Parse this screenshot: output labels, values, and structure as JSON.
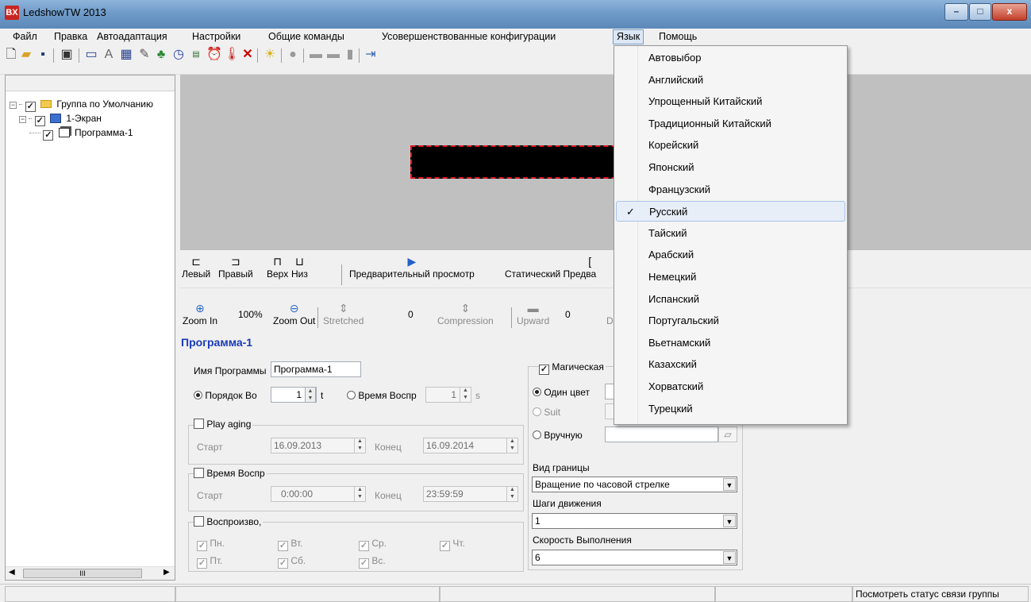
{
  "window": {
    "title": "LedshowTW 2013",
    "logo": "BX",
    "minimize": "–",
    "maximize": "□",
    "close": "x"
  },
  "menu": {
    "items": [
      "Файл",
      "Правка",
      "Автоадаптация",
      "Настройки",
      "Общие команды",
      "Усовершенствованные конфигурации",
      "Язык",
      "Помощь"
    ],
    "active": "Язык"
  },
  "toolbar": {
    "icons": [
      "new-file-icon",
      "open-folder-icon",
      "save-icon",
      "screen-settings-icon",
      "area-icon",
      "text-icon",
      "table-icon",
      "edit-icon",
      "animation-icon",
      "clock-icon",
      "date-time-icon",
      "counter-icon",
      "temperature-icon",
      "delete-icon",
      "light-icon",
      "stop-icon",
      "send-icon",
      "send-all-icon",
      "usb-icon",
      "exit-icon"
    ]
  },
  "tree": {
    "group": "Группа по Умолчанию",
    "screen": "1-Экран",
    "program": "Программа-1",
    "scroll_thumb": "III"
  },
  "preview_toolbar": {
    "left": "Левый",
    "right": "Правый",
    "top": "Верх",
    "bottom": "Низ",
    "preview": "Предварительный просмотр",
    "static_preview": "Статический Предва"
  },
  "zoom_toolbar": {
    "zoom_in": "Zoom In",
    "zoom_pct": "100%",
    "zoom_out": "Zoom Out",
    "stretched": "Stretched",
    "stretched_val": "0",
    "compression": "Compression",
    "upward": "Upward",
    "upward_val": "0",
    "down": "D"
  },
  "properties": {
    "title": "Программа-1",
    "name_label": "Имя Программы",
    "name_value": "Программа-1",
    "order_label": "Порядок Во",
    "order_value": "1",
    "order_unit": "t",
    "time_label": "Время Воспр",
    "time_value": "1",
    "time_unit": "s",
    "aging_label": "Play aging",
    "start_label": "Старт",
    "end_label": "Конец",
    "aging_start": "16.09.2013",
    "aging_end": "16.09.2014",
    "play_time_label": "Время Воспр",
    "time_start": "0:00:00",
    "time_end": "23:59:59",
    "playback_label": "Воспроизво,",
    "days": [
      "Пн.",
      "Вт.",
      "Ср.",
      "Чт.",
      "Пт.",
      "Сб.",
      "Вс."
    ]
  },
  "border": {
    "magic_label": "Магическая",
    "single_color": "Один цвет",
    "suit": "Suit",
    "manual": "Вручную",
    "border_type_label": "Вид границы",
    "border_type_value": "Вращение по часовой стрелке",
    "steps_label": "Шаги движения",
    "steps_value": "1",
    "speed_label": "Скорость Выполнения",
    "speed_value": "6"
  },
  "language_menu": {
    "items": [
      "Автовыбор",
      "Английский",
      "Упрощенный Китайский",
      "Традиционный Китайский",
      "Корейский",
      "Японский",
      "Французский",
      "Русский",
      "Тайский",
      "Арабский",
      "Немецкий",
      "Испанский",
      "Португальский",
      "Вьетнамский",
      "Казахский",
      "Хорватский",
      "Турецкий"
    ],
    "selected": "Русский",
    "check": "✓"
  },
  "status": {
    "text": "Посмотреть статус связи группы"
  }
}
